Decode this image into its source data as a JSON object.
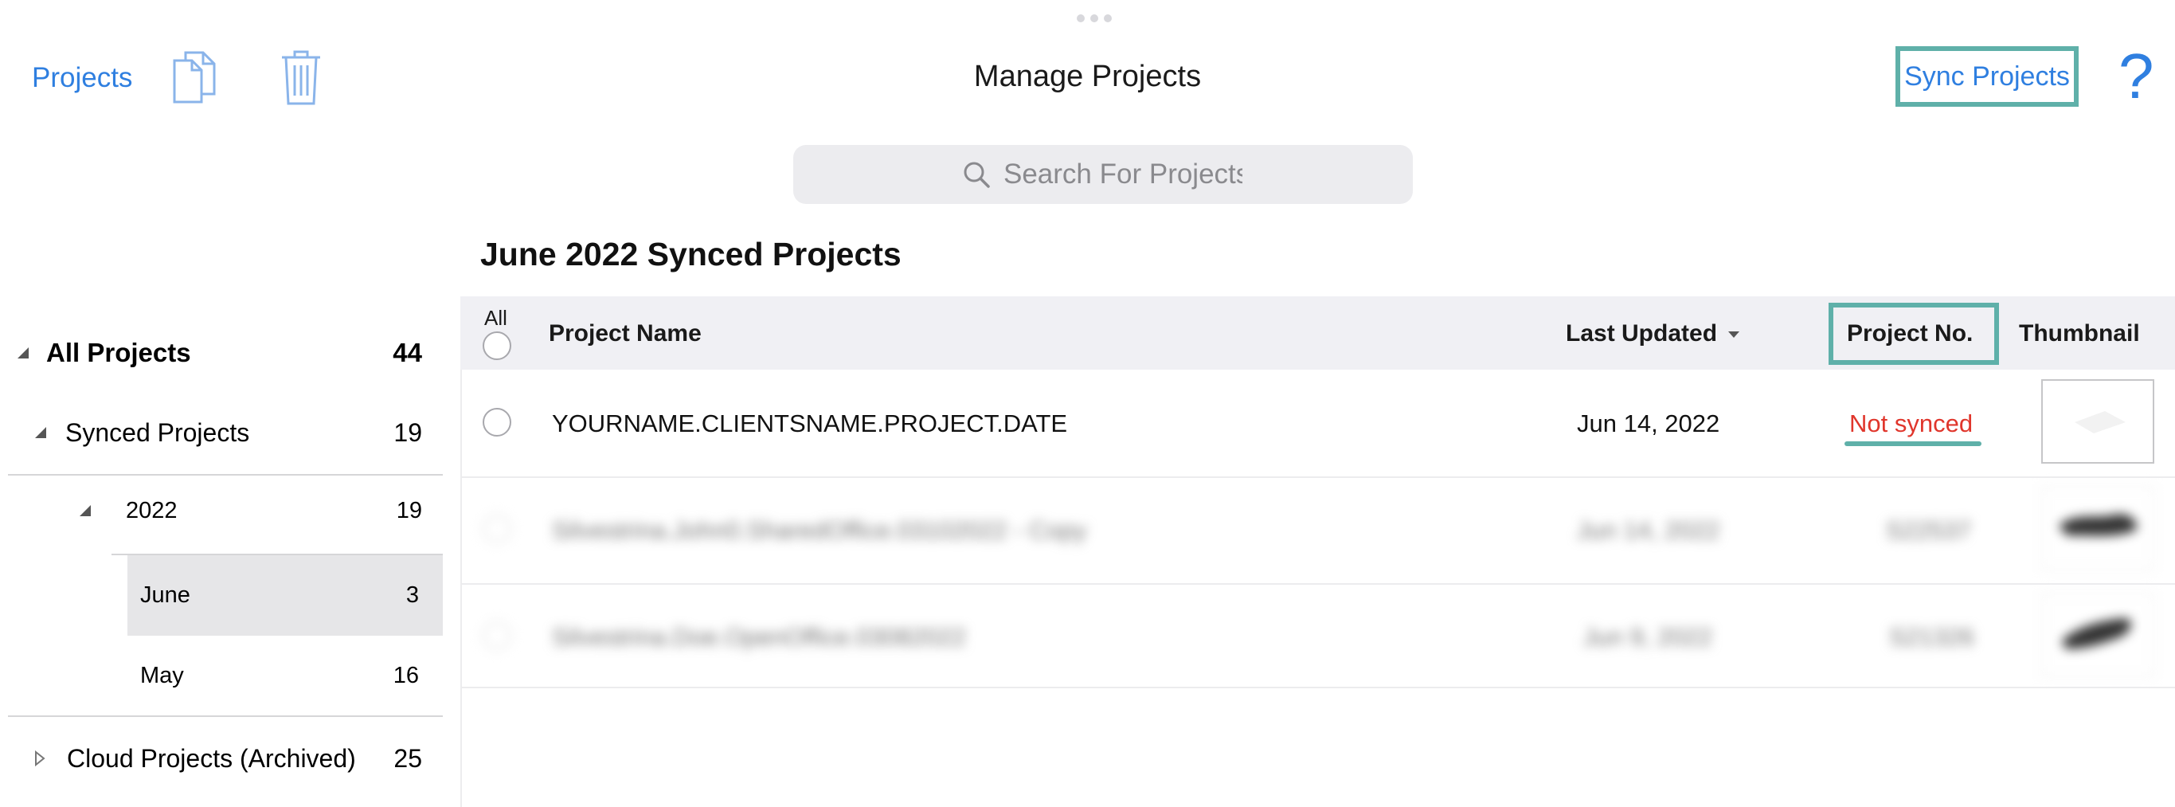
{
  "header": {
    "back_label": "Projects",
    "title": "Manage Projects",
    "sync_label": "Sync Projects",
    "help_label": "?",
    "icons": [
      "copy-icon",
      "trash-icon",
      "help-icon"
    ]
  },
  "search": {
    "placeholder": "Search For Projects"
  },
  "section_title": "June 2022 Synced Projects",
  "sidebar": {
    "all": {
      "label": "All Projects",
      "count": "44"
    },
    "synced": {
      "label": "Synced Projects",
      "count": "19"
    },
    "year": {
      "label": "2022",
      "count": "19"
    },
    "months": [
      {
        "label": "June",
        "count": "3",
        "selected": true
      },
      {
        "label": "May",
        "count": "16",
        "selected": false
      }
    ],
    "cloud": {
      "label": "Cloud Projects (Archived)",
      "count": "25"
    }
  },
  "table": {
    "headers": {
      "all": "All",
      "name": "Project Name",
      "updated": "Last Updated",
      "number": "Project No.",
      "thumbnail": "Thumbnail"
    },
    "rows": [
      {
        "name": "YOURNAME.CLIENTSNAME.PROJECT.DATE",
        "updated": "Jun 14, 2022",
        "number": "Not synced",
        "blurred": false
      },
      {
        "name": "Silvestrina.John0.SharedOffice.03102022 - Copy",
        "updated": "Jun 14, 2022",
        "number": "S22537",
        "blurred": true
      },
      {
        "name": "Silvestrina.Doe.OpenOffice.03082022",
        "updated": "Jun 9, 2022",
        "number": "S21326",
        "blurred": true
      }
    ]
  },
  "colors": {
    "accent": "#2f7fe0",
    "highlight": "#5fb0a9",
    "error": "#e0362c"
  }
}
